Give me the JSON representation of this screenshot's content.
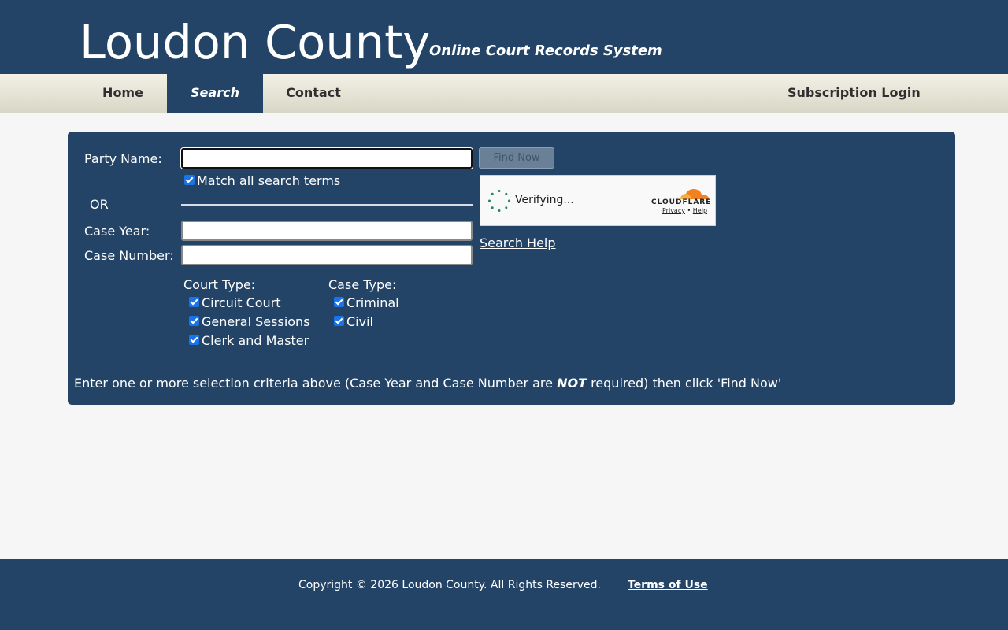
{
  "header": {
    "title": "Loudon County",
    "subtitle": "Online Court Records System"
  },
  "nav": {
    "home": "Home",
    "search": "Search",
    "contact": "Contact",
    "login": "Subscription Login",
    "active": "Search"
  },
  "form": {
    "party_name_label": "Party Name:",
    "party_name_value": "",
    "match_all_label": "Match all search terms",
    "match_all_checked": true,
    "or_label": "OR",
    "case_year_label": "Case Year:",
    "case_year_value": "",
    "case_number_label": "Case Number:",
    "case_number_value": "",
    "find_button": "Find Now",
    "court_type_label": "Court Type:",
    "court_types": [
      {
        "label": "Circuit Court",
        "checked": true
      },
      {
        "label": "General Sessions",
        "checked": true
      },
      {
        "label": "Clerk and Master",
        "checked": true
      }
    ],
    "case_type_label": "Case Type:",
    "case_types": [
      {
        "label": "Criminal",
        "checked": true
      },
      {
        "label": "Civil",
        "checked": true
      }
    ],
    "search_help": "Search Help",
    "instructions_pre": "Enter one or more selection criteria above (Case Year and Case Number are",
    "instructions_emph": "NOT",
    "instructions_post": "required) then click 'Find Now'"
  },
  "captcha": {
    "status": "Verifying...",
    "brand": "CLOUDFLARE",
    "privacy": "Privacy",
    "separator": "•",
    "help": "Help"
  },
  "footer": {
    "copyright": "Copyright © 2026 Loudon County. All Rights Reserved.",
    "terms": "Terms of Use"
  },
  "colors": {
    "primary": "#234466",
    "nav_bg": "#e6e4d6",
    "page_bg": "#f6f6f6",
    "checkbox": "#1a73e8",
    "cloudflare_orange": "#f48120"
  }
}
